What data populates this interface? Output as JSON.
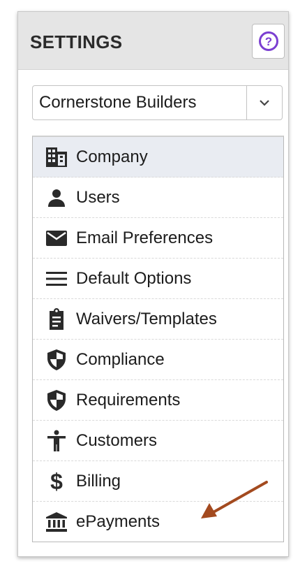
{
  "header": {
    "title": "SETTINGS",
    "help_label": "?"
  },
  "company_select": {
    "value": "Cornerstone Builders"
  },
  "menu": {
    "items": [
      {
        "label": "Company",
        "icon": "building-icon",
        "active": true
      },
      {
        "label": "Users",
        "icon": "person-icon"
      },
      {
        "label": "Email Preferences",
        "icon": "envelope-icon"
      },
      {
        "label": "Default Options",
        "icon": "menu-lines-icon"
      },
      {
        "label": "Waivers/Templates",
        "icon": "clipboard-icon"
      },
      {
        "label": "Compliance",
        "icon": "shield-icon"
      },
      {
        "label": "Requirements",
        "icon": "shield-icon"
      },
      {
        "label": "Customers",
        "icon": "accessibility-person-icon"
      },
      {
        "label": "Billing",
        "icon": "dollar-icon"
      },
      {
        "label": "ePayments",
        "icon": "bank-icon"
      }
    ]
  },
  "colors": {
    "help_accent": "#7b3fd1",
    "annotation_arrow": "#a34a1f",
    "active_row": "#e9ecf2"
  }
}
